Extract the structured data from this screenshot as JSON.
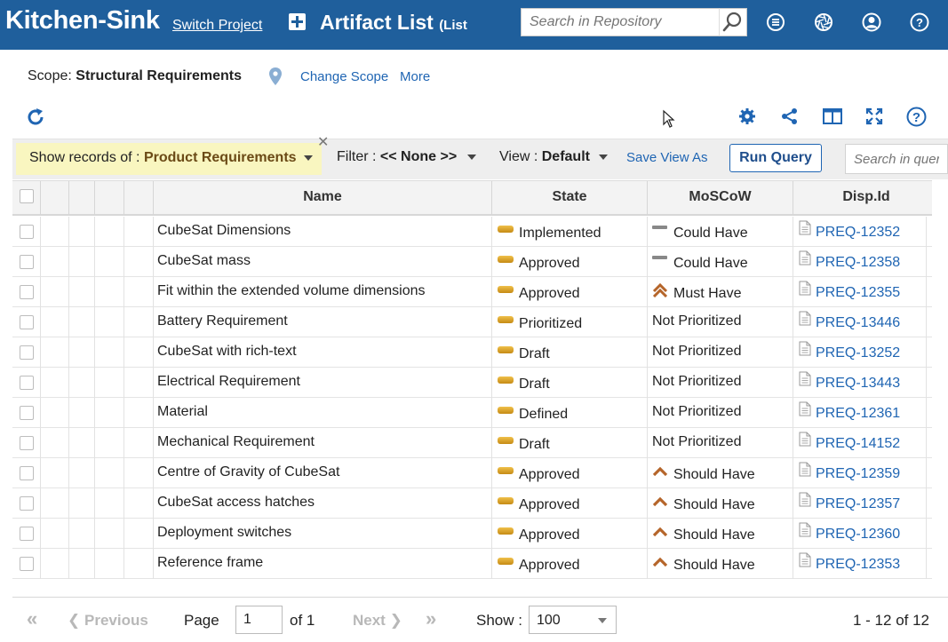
{
  "header": {
    "project": "Kitchen-Sink",
    "switch_project": "Switch Project",
    "title": "Artifact List",
    "title_suffix": "(List",
    "search_placeholder": "Search in Repository"
  },
  "scope": {
    "label": "Scope:",
    "value": "Structural Requirements",
    "change_scope": "Change Scope",
    "more": "More"
  },
  "filter_bar": {
    "show_records_label": "Show records of :",
    "show_records_value": "Product Requirements",
    "filter_label": "Filter :",
    "filter_value": "<< None >>",
    "view_label": "View :",
    "view_value": "Default",
    "save_view_as": "Save View As",
    "run_query": "Run Query",
    "search_placeholder": "Search in query"
  },
  "columns": {
    "name": "Name",
    "state": "State",
    "moscow": "MoSCoW",
    "disp_id": "Disp.Id"
  },
  "rows": [
    {
      "name": "CubeSat Dimensions",
      "state": "Implemented",
      "moscow": "Could Have",
      "moscow_icon": "dash-icon",
      "id": "PREQ-12352"
    },
    {
      "name": "CubeSat mass",
      "state": "Approved",
      "moscow": "Could Have",
      "moscow_icon": "dash-icon",
      "id": "PREQ-12358"
    },
    {
      "name": "Fit within the extended volume dimensions",
      "state": "Approved",
      "moscow": "Must Have",
      "moscow_icon": "double-chevron-up-icon",
      "id": "PREQ-12355"
    },
    {
      "name": "Battery Requirement",
      "state": "Prioritized",
      "moscow": "Not Prioritized",
      "moscow_icon": "",
      "id": "PREQ-13446"
    },
    {
      "name": "CubeSat with rich-text",
      "state": "Draft",
      "moscow": "Not Prioritized",
      "moscow_icon": "",
      "id": "PREQ-13252"
    },
    {
      "name": "Electrical Requirement",
      "state": "Draft",
      "moscow": "Not Prioritized",
      "moscow_icon": "",
      "id": "PREQ-13443"
    },
    {
      "name": "Material",
      "state": "Defined",
      "moscow": "Not Prioritized",
      "moscow_icon": "",
      "id": "PREQ-12361"
    },
    {
      "name": "Mechanical Requirement",
      "state": "Draft",
      "moscow": "Not Prioritized",
      "moscow_icon": "",
      "id": "PREQ-14152"
    },
    {
      "name": "Centre of Gravity of CubeSat",
      "state": "Approved",
      "moscow": "Should Have",
      "moscow_icon": "chevron-up-icon",
      "id": "PREQ-12359"
    },
    {
      "name": "CubeSat access hatches",
      "state": "Approved",
      "moscow": "Should Have",
      "moscow_icon": "chevron-up-icon",
      "id": "PREQ-12357"
    },
    {
      "name": "Deployment switches",
      "state": "Approved",
      "moscow": "Should Have",
      "moscow_icon": "chevron-up-icon",
      "id": "PREQ-12360"
    },
    {
      "name": "Reference frame",
      "state": "Approved",
      "moscow": "Should Have",
      "moscow_icon": "chevron-up-icon",
      "id": "PREQ-12353"
    }
  ],
  "pagination": {
    "first": "«",
    "previous": "Previous",
    "page_label": "Page",
    "page_value": "1",
    "of_label": "of 1",
    "next": "Next",
    "last": "»",
    "show_label": "Show :",
    "show_value": "100",
    "summary": "1 - 12 of 12"
  },
  "colors": {
    "header_bg": "#1f5f9c",
    "link": "#1f65b3",
    "records_bg": "#f9f6c0"
  }
}
